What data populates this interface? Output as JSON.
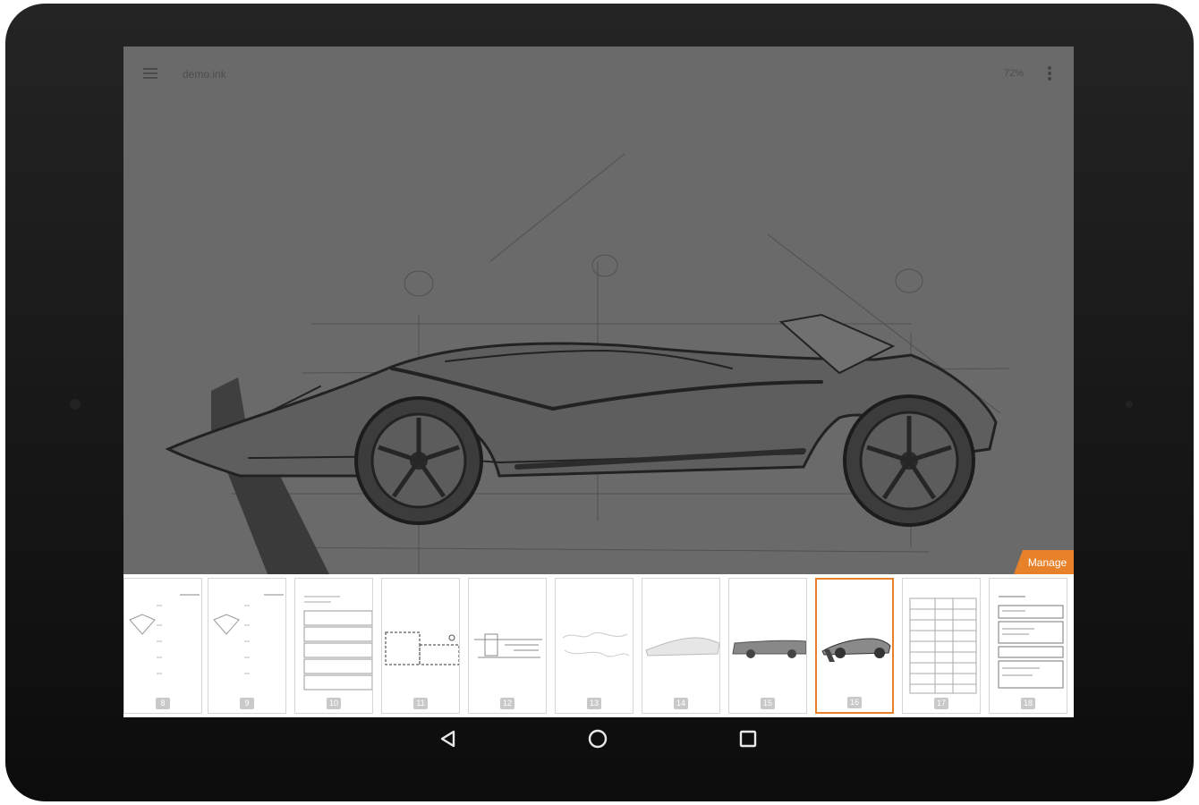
{
  "toolbar": {
    "file_name": "demo.ink",
    "zoom": "72%",
    "menu_icon": "hamburger-menu-icon",
    "more_icon": "more-vertical-icon"
  },
  "page_strip": {
    "manage_label": "Manage",
    "accent_color": "#e8822a",
    "selected_page": "16",
    "pages": [
      "8",
      "9",
      "10",
      "11",
      "12",
      "13",
      "14",
      "15",
      "16",
      "17",
      "18"
    ]
  },
  "system_nav": {
    "back_icon": "back-triangle-icon",
    "home_icon": "home-circle-icon",
    "recents_icon": "recents-square-icon"
  }
}
